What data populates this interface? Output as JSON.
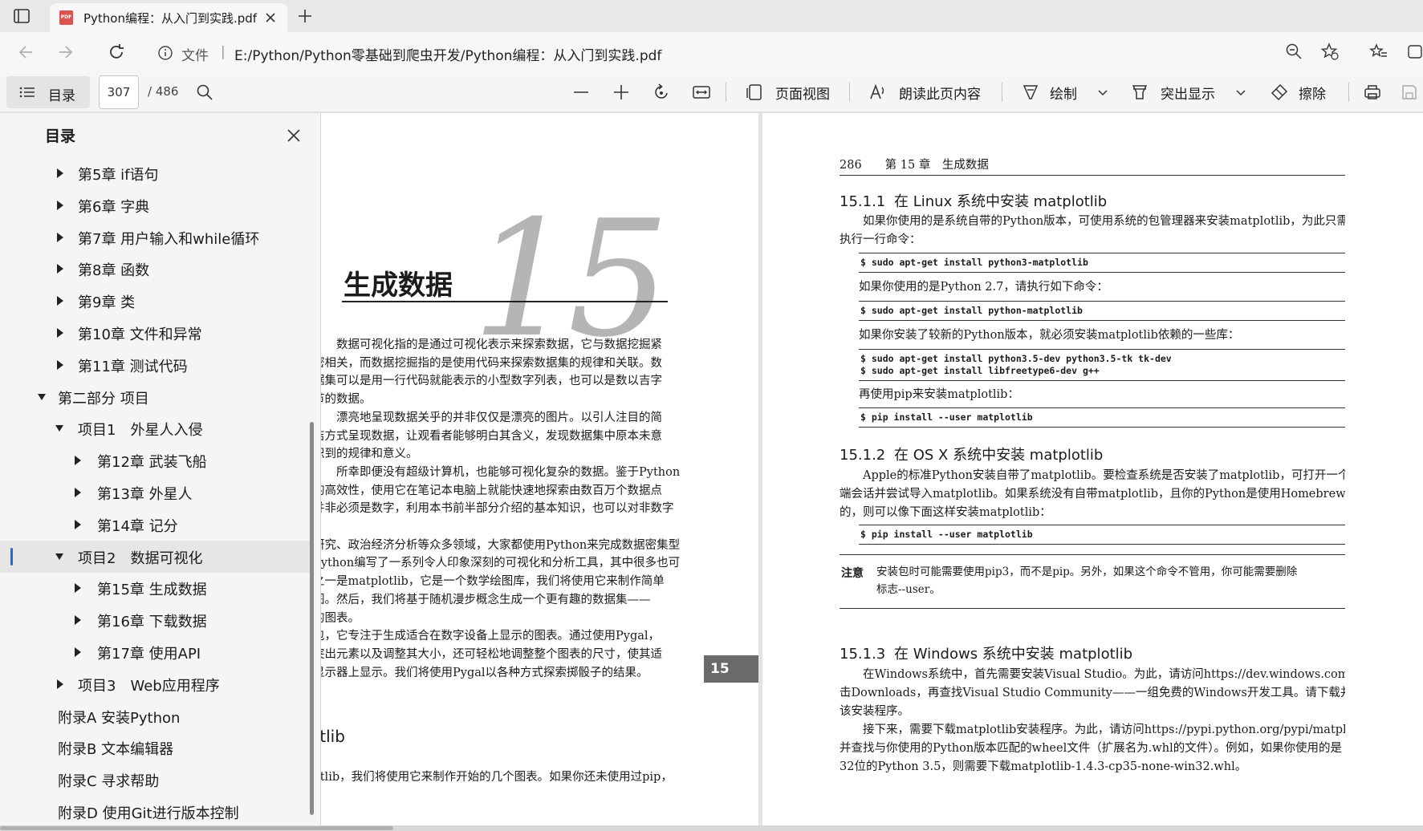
{
  "browser": {
    "tab_title": "Python编程：从入门到实践.pdf",
    "favicon_label": "PDF",
    "url_label": "文件",
    "url_separator": "|",
    "url": "E:/Python/Python零基础到爬虫开发/Python编程：从入门到实践.pdf"
  },
  "toolbar": {
    "toc_label": "目录",
    "page_current": "307",
    "page_total": "/ 486",
    "page_view_label": "页面视图",
    "read_aloud_label": "朗读此页内容",
    "draw_label": "绘制",
    "highlight_label": "突出显示",
    "erase_label": "擦除"
  },
  "sidebar": {
    "title": "目录",
    "items": [
      {
        "label": "第5章 if语句",
        "level": 2,
        "expanded": false,
        "active": false
      },
      {
        "label": "第6章 字典",
        "level": 2,
        "expanded": false,
        "active": false
      },
      {
        "label": "第7章 用户输入和while循环",
        "level": 2,
        "expanded": false,
        "active": false
      },
      {
        "label": "第8章 函数",
        "level": 2,
        "expanded": false,
        "active": false
      },
      {
        "label": "第9章 类",
        "level": 2,
        "expanded": false,
        "active": false
      },
      {
        "label": "第10章 文件和异常",
        "level": 2,
        "expanded": false,
        "active": false
      },
      {
        "label": "第11章 测试代码",
        "level": 2,
        "expanded": false,
        "active": false
      },
      {
        "label": "第二部分 项目",
        "level": 1,
        "expanded": true,
        "active": false
      },
      {
        "label": "项目1　外星人入侵",
        "level": 2,
        "expanded": true,
        "active": false
      },
      {
        "label": "第12章 武装飞船",
        "level": 3,
        "expanded": false,
        "active": false
      },
      {
        "label": "第13章 外星人",
        "level": 3,
        "expanded": false,
        "active": false
      },
      {
        "label": "第14章 记分",
        "level": 3,
        "expanded": false,
        "active": false
      },
      {
        "label": "项目2　数据可视化",
        "level": 2,
        "expanded": true,
        "active": true
      },
      {
        "label": "第15章 生成数据",
        "level": 3,
        "expanded": false,
        "active": false
      },
      {
        "label": "第16章 下载数据",
        "level": 3,
        "expanded": false,
        "active": false
      },
      {
        "label": "第17章 使用API",
        "level": 3,
        "expanded": false,
        "active": false
      },
      {
        "label": "项目3　Web应用程序",
        "level": 2,
        "expanded": false,
        "active": false
      },
      {
        "label": "附录A 安装Python",
        "level": 1,
        "expanded": null,
        "active": false
      },
      {
        "label": "附录B 文本编辑器",
        "level": 1,
        "expanded": null,
        "active": false
      },
      {
        "label": "附录C 寻求帮助",
        "level": 1,
        "expanded": null,
        "active": false
      },
      {
        "label": "附录D 使用Git进行版本控制",
        "level": 1,
        "expanded": null,
        "active": false
      }
    ]
  },
  "left_page": {
    "chapter_title": "生成数据",
    "chapter_number": "15",
    "chapter_tab": "15",
    "lines": [
      "　　数据可视化指的是通过可视化表示来探索数据，它与数据挖掘紧",
      "密相关，而数据挖掘指的是使用代码来探索数据集的规律和关联。数",
      "据集可以是用一行代码就能表示的小型数字列表，也可以是数以吉字",
      "节的数据。",
      "　　漂亮地呈现数据关乎的并非仅仅是漂亮的图片。以引人注目的简",
      "洁方式呈现数据，让观看者能够明白其含义，发现数据集中原本未意",
      "识到的规律和意义。",
      "　　所幸即便没有超级计算机，也能够可视化复杂的数据。鉴于Python",
      "的高效性，使用它在笔记本电脑上就能快速地探索由数百万个数据点",
      "并非必须是数字，利用本书前半部分介绍的基本知识，也可以对非数字",
      "",
      "研究、政治经济分析等众多领域，大家都使用Python来完成数据密集型",
      "Python编写了一系列令人印象深刻的可视化和分析工具，其中很多也可",
      "之一是matplotlib，它是一个数学绘图库，我们将使用它来制作简单",
      "图。然后，我们将基于随机漫步概念生成一个更有趣的数据集——",
      "的图表。",
      "包，它专注于生成适合在数字设备上显示的图表。通过使用Pygal，",
      "突出元素以及调整其大小，还可轻松地调整整个图表的尺寸，使其适",
      "显示器上显示。我们将使用Pygal以各种方式探索掷骰子的结果。"
    ],
    "section_head": "otlib",
    "last_line": "otlib，我们将使用它来制作开始的几个图表。如果你还未使用过pip，"
  },
  "right_page": {
    "header": "286　　第 15 章　生成数据",
    "s1_num": "15.1.1",
    "s1_title": "在 Linux 系统中安装 matplotlib",
    "p1a": "　　如果你使用的是系统自带的Python版本，可使用系统的包管理器来安装matplotlib，为此只需",
    "p1b": "执行一行命令：",
    "code1": "$ sudo apt-get install python3-matplotlib",
    "p2": "如果你使用的是Python 2.7，请执行如下命令：",
    "code2": "$ sudo apt-get install python-matplotlib",
    "p3": "如果你安装了较新的Python版本，就必须安装matplotlib依赖的一些库：",
    "code3": "$ sudo apt-get install python3.5-dev python3.5-tk tk-dev\n$ sudo apt-get install libfreetype6-dev g++",
    "p4": "再使用pip来安装matplotlib：",
    "code4": "$ pip install --user matplotlib",
    "s2_num": "15.1.2",
    "s2_title": "在 OS X 系统中安装 matplotlib",
    "p5a": "　　Apple的标准Python安装自带了matplotlib。要检查系统是否安装了matplotlib，可打开一个终",
    "p5b": "端会话并尝试导入matplotlib。如果系统没有自带matplotlib，且你的Python是使用Homebrew安装",
    "p5c": "的，则可以像下面这样安装matplotlib：",
    "code5": "$ pip install --user matplotlib",
    "note_label": "注意",
    "note_line1": "安装包时可能需要使用pip3，而不是pip。另外，如果这个命令不管用，你可能需要删除",
    "note_line2": "标志--user。",
    "s3_num": "15.1.3",
    "s3_title": "在 Windows 系统中安装 matplotlib",
    "p6a": "　　在Windows系统中，首先需要安装Visual Studio。为此，请访问https://dev.windows.com/，单",
    "p6b": "击Downloads，再查找Visual Studio Community——一组免费的Windows开发工具。请下载并运行",
    "p6c": "该安装程序。",
    "p7a": "　　接下来，需要下载matplotlib安装程序。为此，请访问https://pypi.python.org/pypi/matplotlib/，",
    "p7b": "并查找与你使用的Python版本匹配的wheel文件（扩展名为.whl的文件）。例如，如果你使用的是",
    "p7c": "32位的Python 3.5，则需要下载matplotlib-1.4.3-cp35-none-win32.whl。"
  }
}
